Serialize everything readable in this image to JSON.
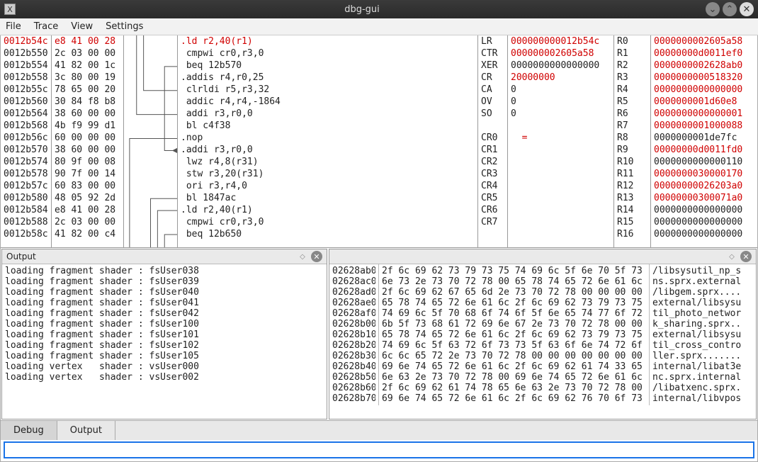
{
  "window": {
    "title": "dbg-gui",
    "icon_glyph": "X"
  },
  "menu": {
    "items": [
      "File",
      "Trace",
      "View",
      "Settings"
    ]
  },
  "disasm": [
    {
      "addr": "0012b54c",
      "bytes": "e8 41 00 28",
      "mnem": ".ld r2,40(r1)",
      "hot": true
    },
    {
      "addr": "0012b550",
      "bytes": "2c 03 00 00",
      "mnem": "cmpwi cr0,r3,0"
    },
    {
      "addr": "0012b554",
      "bytes": "41 82 00 1c",
      "mnem": "beq 12b570"
    },
    {
      "addr": "0012b558",
      "bytes": "3c 80 00 19",
      "mnem": ".addis r4,r0,25"
    },
    {
      "addr": "0012b55c",
      "bytes": "78 65 00 20",
      "mnem": "clrldi r5,r3,32"
    },
    {
      "addr": "0012b560",
      "bytes": "30 84 f8 b8",
      "mnem": "addic r4,r4,-1864"
    },
    {
      "addr": "0012b564",
      "bytes": "38 60 00 00",
      "mnem": "addi r3,r0,0"
    },
    {
      "addr": "0012b568",
      "bytes": "4b f9 99 d1",
      "mnem": "bl c4f38"
    },
    {
      "addr": "0012b56c",
      "bytes": "60 00 00 00",
      "mnem": ".nop"
    },
    {
      "addr": "0012b570",
      "bytes": "38 60 00 00",
      "mnem": ".addi r3,r0,0"
    },
    {
      "addr": "0012b574",
      "bytes": "80 9f 00 08",
      "mnem": "lwz r4,8(r31)"
    },
    {
      "addr": "0012b578",
      "bytes": "90 7f 00 14",
      "mnem": "stw r3,20(r31)"
    },
    {
      "addr": "0012b57c",
      "bytes": "60 83 00 00",
      "mnem": "ori r3,r4,0"
    },
    {
      "addr": "0012b580",
      "bytes": "48 05 92 2d",
      "mnem": "bl 1847ac"
    },
    {
      "addr": "0012b584",
      "bytes": "e8 41 00 28",
      "mnem": ".ld r2,40(r1)"
    },
    {
      "addr": "0012b588",
      "bytes": "2c 03 00 00",
      "mnem": "cmpwi cr0,r3,0"
    },
    {
      "addr": "0012b58c",
      "bytes": "41 82 00 c4",
      "mnem": "beq 12b650"
    }
  ],
  "regs_left": [
    {
      "n": "LR",
      "v": "000000000012b54c",
      "red": true
    },
    {
      "n": "CTR",
      "v": "000000002605a58",
      "red": true
    },
    {
      "n": "XER",
      "v": "0000000000000000"
    },
    {
      "n": "CR",
      "v": "20000000",
      "red": true
    },
    {
      "n": "CA",
      "v": "0"
    },
    {
      "n": "OV",
      "v": "0"
    },
    {
      "n": "SO",
      "v": "0"
    },
    {
      "n": "",
      "v": ""
    },
    {
      "n": "CR0",
      "v": "  =",
      "red": true
    },
    {
      "n": "CR1",
      "v": ""
    },
    {
      "n": "CR2",
      "v": ""
    },
    {
      "n": "CR3",
      "v": ""
    },
    {
      "n": "CR4",
      "v": ""
    },
    {
      "n": "CR5",
      "v": ""
    },
    {
      "n": "CR6",
      "v": ""
    },
    {
      "n": "CR7",
      "v": ""
    }
  ],
  "regs_right": [
    {
      "n": "R0",
      "v": "0000000002605a58",
      "red": true
    },
    {
      "n": "R1",
      "v": "00000000d0011ef0",
      "red": true
    },
    {
      "n": "R2",
      "v": "0000000002628ab0",
      "red": true
    },
    {
      "n": "R3",
      "v": "0000000000518320",
      "red": true
    },
    {
      "n": "R4",
      "v": "0000000000000000",
      "red": true
    },
    {
      "n": "R5",
      "v": "0000000001d60e8",
      "red": true
    },
    {
      "n": "R6",
      "v": "0000000000000001",
      "red": true
    },
    {
      "n": "R7",
      "v": "0000000001000088",
      "red": true
    },
    {
      "n": "R8",
      "v": "0000000001de7fc"
    },
    {
      "n": "R9",
      "v": "00000000d0011fd0",
      "red": true
    },
    {
      "n": "R10",
      "v": "0000000000000110"
    },
    {
      "n": "R11",
      "v": "0000000030000170",
      "red": true
    },
    {
      "n": "R12",
      "v": "00000000026203a0",
      "red": true
    },
    {
      "n": "R13",
      "v": "00000000300071a0",
      "red": true
    },
    {
      "n": "R14",
      "v": "0000000000000000"
    },
    {
      "n": "R15",
      "v": "0000000000000000"
    },
    {
      "n": "R16",
      "v": "0000000000000000"
    }
  ],
  "output_panel": {
    "title": "Output",
    "lines": [
      "loading fragment shader : fsUser038",
      "loading fragment shader : fsUser039",
      "loading fragment shader : fsUser040",
      "loading fragment shader : fsUser041",
      "loading fragment shader : fsUser042",
      "loading fragment shader : fsUser100",
      "loading fragment shader : fsUser101",
      "loading fragment shader : fsUser102",
      "loading fragment shader : fsUser105",
      "loading vertex   shader : vsUser000",
      "loading vertex   shader : vsUser002"
    ]
  },
  "hex_panel": {
    "rows": [
      {
        "a": "02628ab0",
        "b": "2f 6c 69 62 73 79 73 75 74 69 6c 5f 6e 70 5f 73",
        "c": "/libsysutil_np_s"
      },
      {
        "a": "02628ac0",
        "b": "6e 73 2e 73 70 72 78 00 65 78 74 65 72 6e 61 6c",
        "c": "ns.sprx.external"
      },
      {
        "a": "02628ad0",
        "b": "2f 6c 69 62 67 65 6d 2e 73 70 72 78 00 00 00 00",
        "c": "/libgem.sprx...."
      },
      {
        "a": "02628ae0",
        "b": "65 78 74 65 72 6e 61 6c 2f 6c 69 62 73 79 73 75",
        "c": "external/libsysu"
      },
      {
        "a": "02628af0",
        "b": "74 69 6c 5f 70 68 6f 74 6f 5f 6e 65 74 77 6f 72",
        "c": "til_photo_networ"
      },
      {
        "a": "02628b00",
        "b": "6b 5f 73 68 61 72 69 6e 67 2e 73 70 72 78 00 00",
        "c": "k_sharing.sprx.."
      },
      {
        "a": "02628b10",
        "b": "65 78 74 65 72 6e 61 6c 2f 6c 69 62 73 79 73 75",
        "c": "external/libsysu"
      },
      {
        "a": "02628b20",
        "b": "74 69 6c 5f 63 72 6f 73 73 5f 63 6f 6e 74 72 6f",
        "c": "til_cross_contro"
      },
      {
        "a": "02628b30",
        "b": "6c 6c 65 72 2e 73 70 72 78 00 00 00 00 00 00 00",
        "c": "ller.sprx......."
      },
      {
        "a": "02628b40",
        "b": "69 6e 74 65 72 6e 61 6c 2f 6c 69 62 61 74 33 65",
        "c": "internal/libat3e"
      },
      {
        "a": "02628b50",
        "b": "6e 63 2e 73 70 72 78 00 69 6e 74 65 72 6e 61 6c",
        "c": "nc.sprx.internal"
      },
      {
        "a": "02628b60",
        "b": "2f 6c 69 62 61 74 78 65 6e 63 2e 73 70 72 78 00",
        "c": "/libatxenc.sprx."
      },
      {
        "a": "02628b70",
        "b": "69 6e 74 65 72 6e 61 6c 2f 6c 69 62 76 70 6f 73",
        "c": "internal/libvpos"
      }
    ]
  },
  "tabs": {
    "items": [
      "Debug",
      "Output"
    ],
    "active": 0
  },
  "cmdline": {
    "value": ""
  }
}
